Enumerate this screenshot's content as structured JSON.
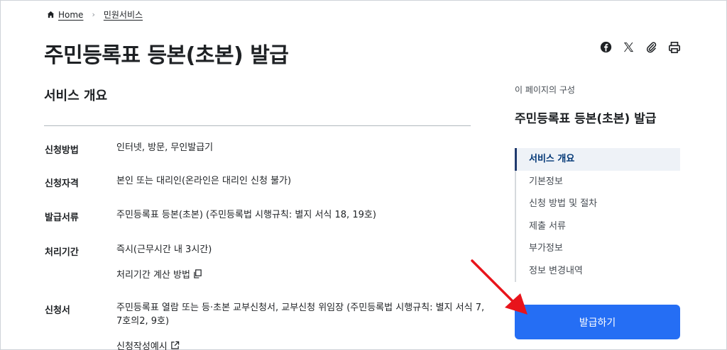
{
  "breadcrumb": {
    "home": "Home",
    "current": "민원서비스"
  },
  "page": {
    "title": "주민등록표 등본(초본) 발급"
  },
  "share": {
    "icons": [
      "facebook-icon",
      "x-twitter-icon",
      "attachment-link-icon",
      "print-icon"
    ]
  },
  "section": {
    "title": "서비스 개요"
  },
  "info": {
    "method_label": "신청방법",
    "method_value": "인터넷, 방문, 무인발급기",
    "eligibility_label": "신청자격",
    "eligibility_value": "본인 또는 대리인(온라인은 대리인 신청 불가)",
    "documents_label": "발급서류",
    "documents_value": "주민등록표 등본(초본) (주민등록법 시행규칙: 별지 서식 18, 19호)",
    "period_label": "처리기간",
    "period_value": "즉시(근무시간 내 3시간)",
    "period_link": "처리기간 계산 방법",
    "form_label": "신청서",
    "form_value_line1": "주민등록표 열람 또는 등·초본 교부신청서, 교부신청 위임장 (주민등록법 시행규칙: 별지 서식 7,",
    "form_value_line2": "7호의2, 9호)",
    "form_link": "신청작성예시"
  },
  "toc": {
    "caption": "이 페이지의 구성",
    "title": "주민등록표 등본(초본) 발급",
    "items": [
      {
        "label": "서비스 개요",
        "active": true
      },
      {
        "label": "기본정보",
        "active": false
      },
      {
        "label": "신청 방법 및 절차",
        "active": false
      },
      {
        "label": "제출 서류",
        "active": false
      },
      {
        "label": "부가정보",
        "active": false
      },
      {
        "label": "정보 변경내역",
        "active": false
      }
    ]
  },
  "actions": {
    "issue_label": "발급하기"
  },
  "colors": {
    "primary": "#256ef4",
    "toc_active_bg": "#eef2f7",
    "annotation_arrow": "#e8141b"
  }
}
